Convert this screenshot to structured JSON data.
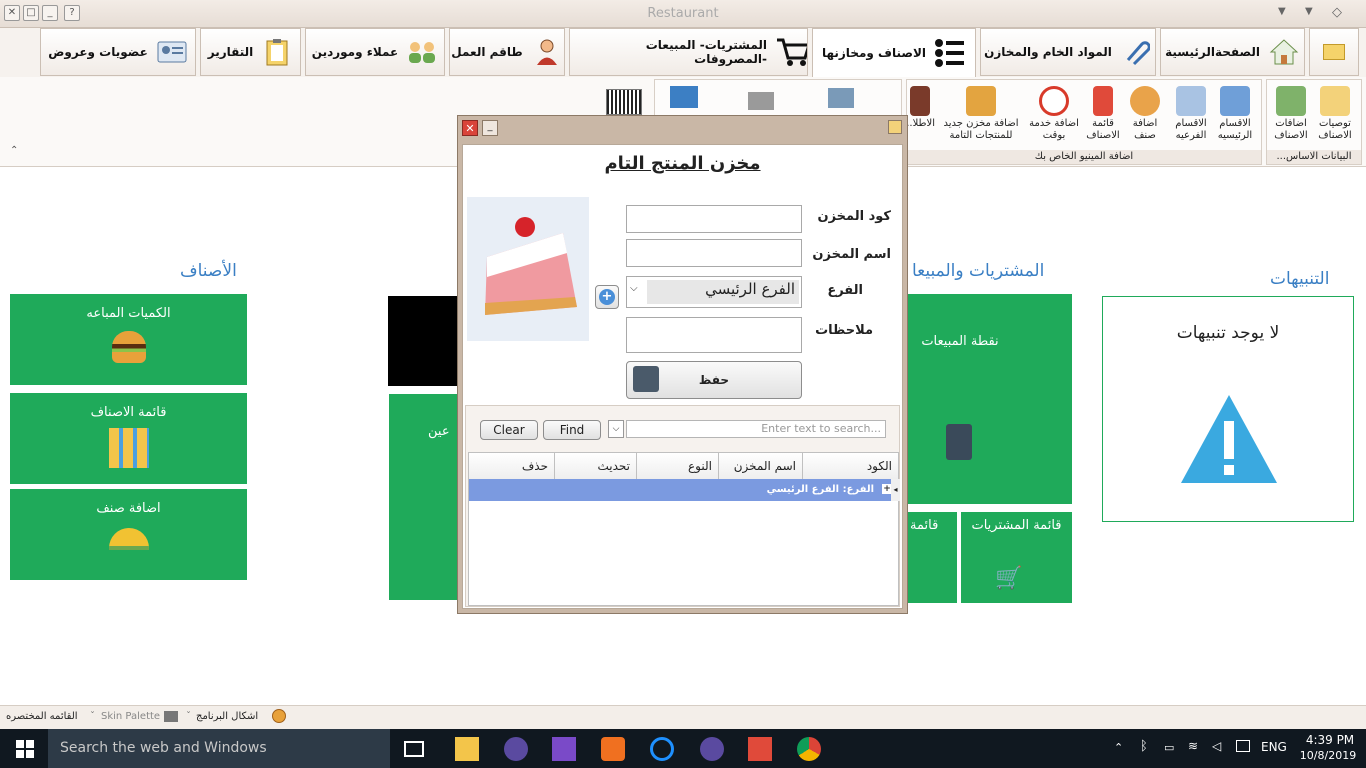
{
  "app": {
    "title": "Restaurant"
  },
  "tabs": [
    {
      "label": "الصفحةالرئيسية"
    },
    {
      "label": "المواد الخام والمخازن"
    },
    {
      "label": "الاصناف ومخازنها"
    },
    {
      "label": "المشتريات- المبيعات -المصروفات"
    },
    {
      "label": "طاقم العمل"
    },
    {
      "label": "عملاء وموردين"
    },
    {
      "label": "التقارير"
    },
    {
      "label": "عضويات وعروض"
    }
  ],
  "ribbon": {
    "groups": [
      {
        "caption": "البيانات الاساس...",
        "items": [
          "توصيات الاصناف",
          "اضافات الاصناف"
        ]
      },
      {
        "caption": "اضافة المينيو الخاص بك",
        "items": [
          "الاقسام الرئيسيه",
          "الاقسام الفرعيه",
          "اضافة صنف",
          "قائمة الاصناف",
          "اضافة خدمة بوقت",
          "اضافة مخزن جديد للمنتجات التامة",
          "الاطلا..."
        ]
      }
    ]
  },
  "sections": {
    "alerts": {
      "title": "التنبيهات",
      "empty_text": "لا يوجد تنبيهات"
    },
    "sales": {
      "title": "المشتريات والمبيعا",
      "tiles": [
        "نقطة المبيعات",
        "قائمة المشتريات",
        "قائمة"
      ]
    },
    "items": {
      "title": "الأصناف",
      "tiles": [
        "الكميات المباعه",
        "قائمة الاصناف",
        "اضافة صنف"
      ]
    },
    "hidden_tile_text": "عين"
  },
  "dialog": {
    "heading": "مخزن المنتج التام",
    "labels": {
      "code": "كود المخزن",
      "name": "اسم المخزن",
      "branch": "الفرع",
      "notes": "ملاحظات"
    },
    "values": {
      "code": "",
      "name": "",
      "branch": "الفرع الرئيسي",
      "notes": ""
    },
    "save_label": "حفظ",
    "search": {
      "clear_label": "Clear",
      "find_label": "Find",
      "placeholder": "Enter text to search..."
    },
    "grid": {
      "columns": [
        "الكود",
        "اسم المخزن",
        "النوع",
        "تحديث",
        "حذف"
      ],
      "group_row": "الفرع: الفرع الرئيسي"
    }
  },
  "statusbar": {
    "items": [
      "القائمه المختصره",
      "اشكال البرنامج",
      "Skin Palette"
    ]
  },
  "taskbar": {
    "search_placeholder": "Search the web and Windows",
    "lang": "ENG",
    "time": "4:39 PM",
    "date": "10/8/2019"
  },
  "colors": {
    "tile_green": "#1faa5a",
    "section_blue": "#3a7fc4",
    "grid_group_row": "#7b9ae0"
  }
}
